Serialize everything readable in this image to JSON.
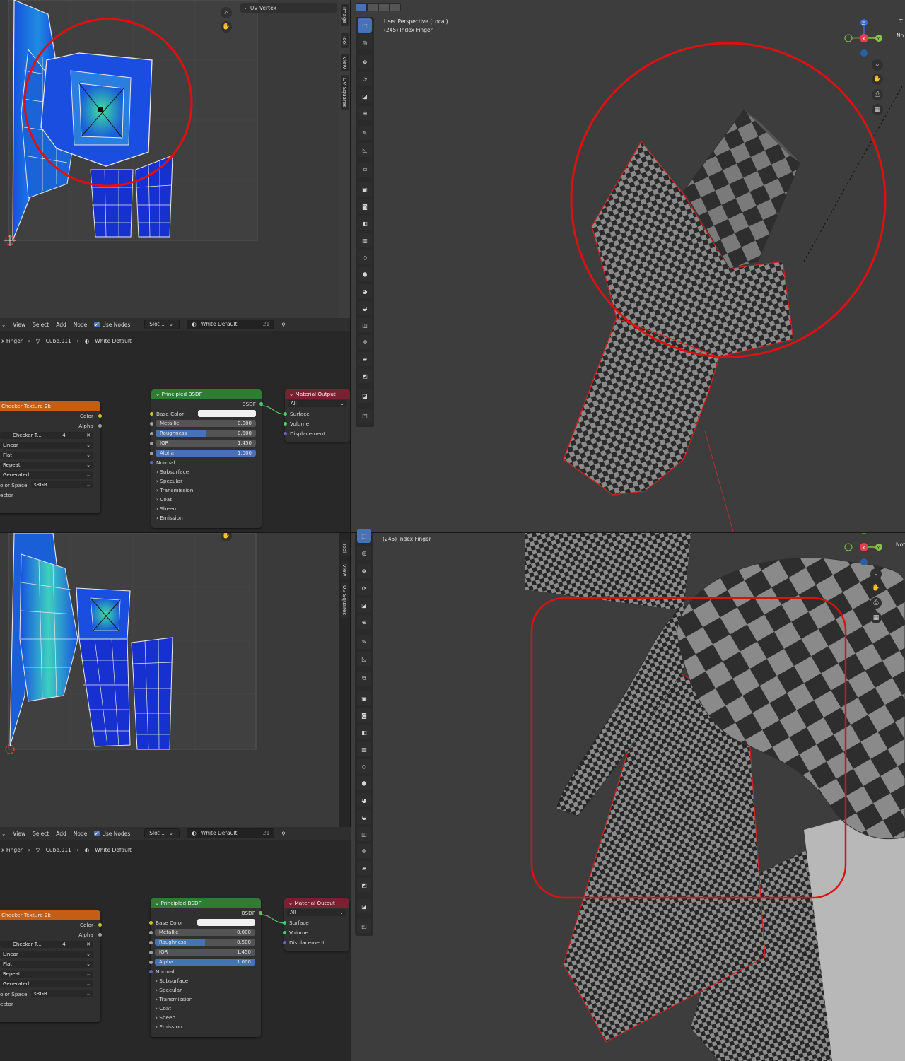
{
  "uv_editor": {
    "sidebar_header": "UV Vertex",
    "tabs": [
      "Image",
      "Tool",
      "View",
      "UV Squares"
    ]
  },
  "node_editor": {
    "menu": {
      "view": "View",
      "select": "Select",
      "add": "Add",
      "node": "Node"
    },
    "use_nodes_label": "Use Nodes",
    "slot": "Slot 1",
    "material_name": "White Default",
    "user_count": "21",
    "breadcrumb": {
      "object": "x Finger",
      "mesh": "Cube.011",
      "material": "White Default"
    },
    "checker_node": {
      "title": "Checker Texture 2k",
      "outputs": [
        "Color",
        "Alpha"
      ],
      "image_name": "Checker T...",
      "image_users": "4",
      "interpolation": "Linear",
      "projection": "Flat",
      "extension": "Repeat",
      "source": "Generated",
      "color_space_label": "olor Space",
      "color_space": "sRGB",
      "vector": "ector"
    },
    "bsdf_node": {
      "title": "Principled BSDF",
      "output": "BSDF",
      "base_color_label": "Base Color",
      "metallic": {
        "label": "Metallic",
        "value": "0.000",
        "fraction": 0
      },
      "roughness": {
        "label": "Roughness",
        "value": "0.500",
        "fraction": 0.5
      },
      "ior": {
        "label": "IOR",
        "value": "1.450",
        "fraction": 0
      },
      "alpha": {
        "label": "Alpha",
        "value": "1.000",
        "fraction": 1
      },
      "normal": "Normal",
      "sections": [
        "Subsurface",
        "Specular",
        "Transmission",
        "Coat",
        "Sheen",
        "Emission"
      ]
    },
    "output_node": {
      "title": "Material Output",
      "target": "All",
      "inputs": [
        "Surface",
        "Volume",
        "Displacement"
      ]
    }
  },
  "viewport_top": {
    "line1": "User Perspective (Local)",
    "line2": "(245) Index Finger",
    "side_label": "No",
    "side_label2": "T"
  },
  "viewport_bottom": {
    "line2": "(245) Index Finger",
    "side_label": "Not"
  },
  "gizmo": {
    "x": "X",
    "y": "Y",
    "z": "Z"
  },
  "colors": {
    "highlight_red": "#e01010",
    "node_header_checker": "#c45e14",
    "node_header_bsdf": "#2f7d32",
    "node_header_output": "#7a2030",
    "accent_blue": "#4772b3"
  },
  "icons": [
    "magnify-icon",
    "hand-icon",
    "camera-icon",
    "grid-icon",
    "select-box-icon",
    "cursor-icon",
    "move-icon",
    "rotate-icon",
    "scale-icon",
    "transform-icon",
    "annotate-icon",
    "measure-icon",
    "add-cube-icon",
    "extrude-icon",
    "inset-icon",
    "bevel-icon",
    "loop-cut-icon",
    "knife-icon",
    "poly-build-icon",
    "spin-icon",
    "smooth-icon",
    "edge-slide-icon",
    "shrink-icon",
    "shear-icon",
    "rip-icon"
  ]
}
